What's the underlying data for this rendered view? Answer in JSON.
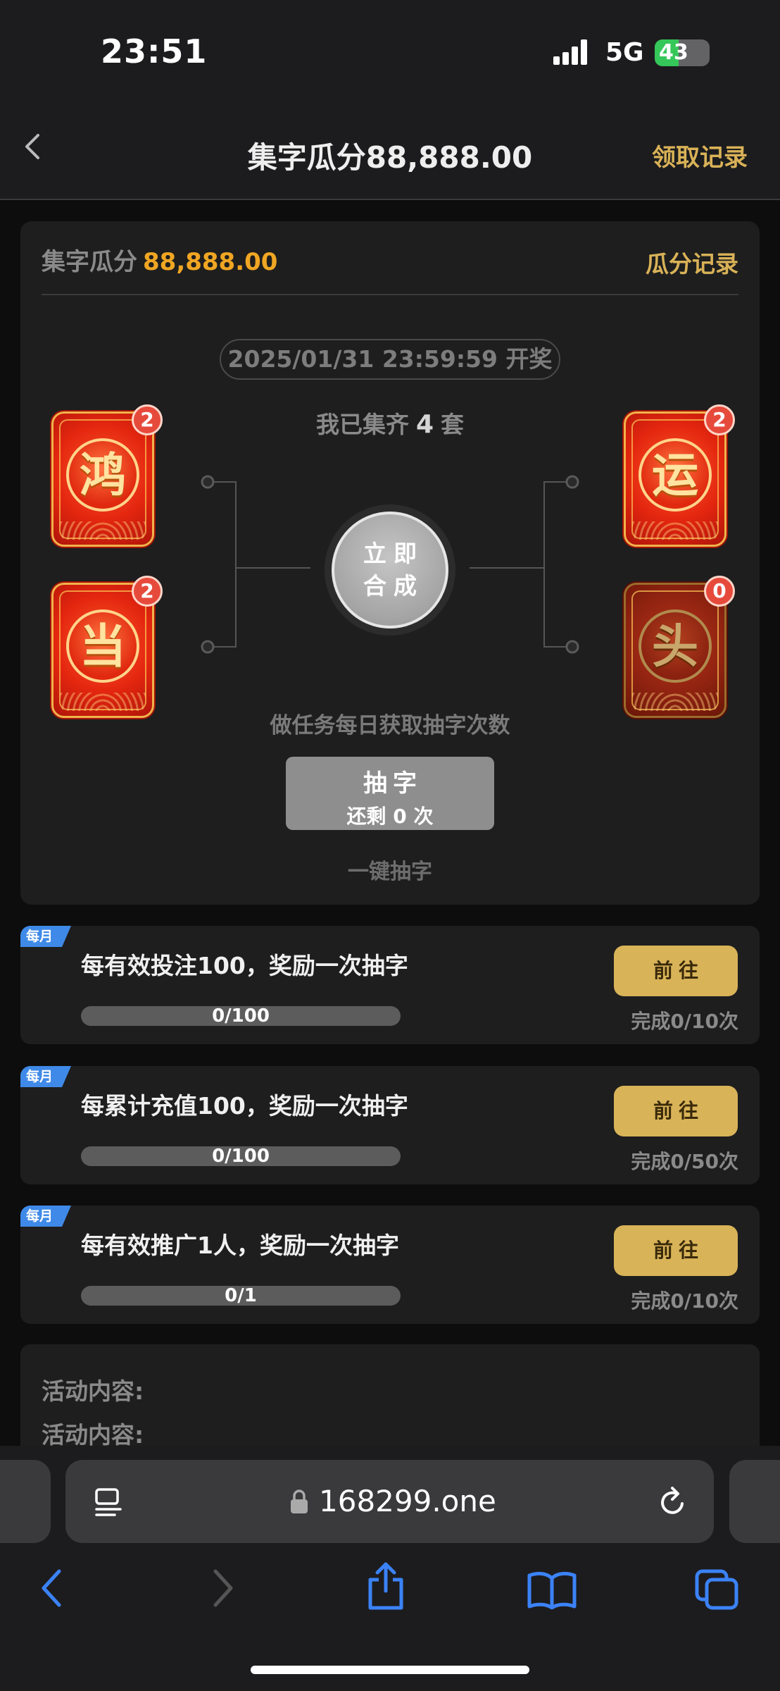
{
  "status_bar": {
    "time": "23:51",
    "network": "5G",
    "battery": "43",
    "battery_level": 0.43
  },
  "nav": {
    "title": "集字瓜分88,888.00",
    "record_link": "领取记录"
  },
  "main": {
    "pool_label": "集字瓜分",
    "pool_amount": "88,888.00",
    "split_record": "瓜分记录",
    "draw_time": "2025/01/31 23:59:59 开奖",
    "collected_prefix": "我已集齐",
    "collected_count": "4",
    "collected_suffix": "套",
    "words": [
      {
        "char": "鸿",
        "count": "2"
      },
      {
        "char": "当",
        "count": "2"
      },
      {
        "char": "运",
        "count": "2"
      },
      {
        "char": "头",
        "count": "0"
      }
    ],
    "synthesize_line1": "立即",
    "synthesize_line2": "合成",
    "task_hint": "做任务每日获取抽字次数",
    "draw_label": "抽字",
    "draw_remaining": "还剩 0 次",
    "one_click": "一键抽字"
  },
  "tasks": [
    {
      "tag": "每月",
      "text": "每有效投注100，奖励一次抽字",
      "progress": "0/100",
      "progress_fraction": 0,
      "button": "前往",
      "count": "完成0/10次"
    },
    {
      "tag": "每月",
      "text": "每累计充值100，奖励一次抽字",
      "progress": "0/100",
      "progress_fraction": 0,
      "button": "前往",
      "count": "完成0/50次"
    },
    {
      "tag": "每月",
      "text": "每有效推广1人，奖励一次抽字",
      "progress": "0/1",
      "progress_fraction": 0,
      "button": "前往",
      "count": "完成0/10次"
    }
  ],
  "activity": {
    "title": "活动内容:",
    "title_repeat": "活动内容:"
  },
  "browser": {
    "url": "168299.one"
  },
  "colors": {
    "gold": "#d9b257",
    "amount": "#f0a623",
    "tag_blue": "#3f8ae8",
    "ios_blue": "#3b82f6"
  }
}
